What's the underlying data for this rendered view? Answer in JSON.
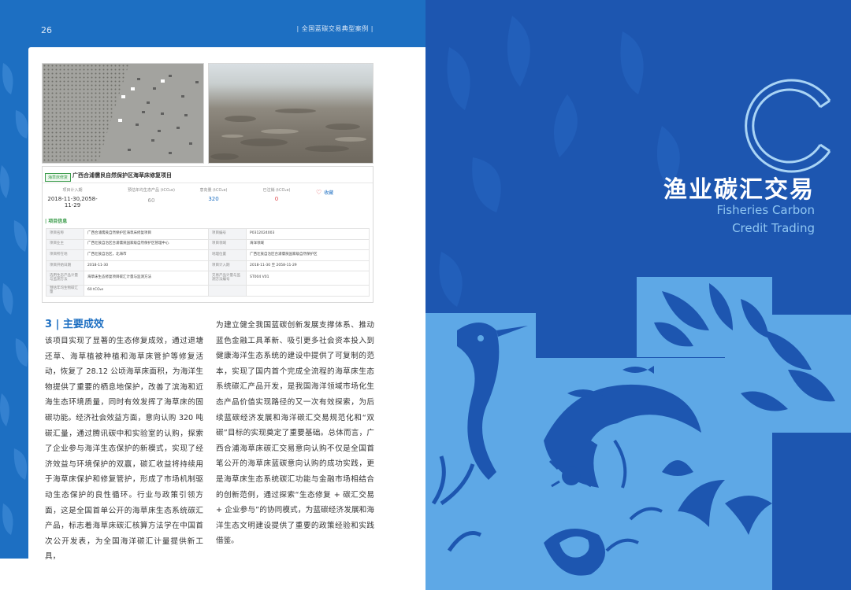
{
  "header": {
    "page_number": "26",
    "running_head": "| 全国蓝碳交易典型案例 |"
  },
  "card": {
    "tag": "海草床修复",
    "title": "广西合浦儒艮自然保护区海草床修复项目",
    "stats": [
      {
        "label": "项目计入期",
        "value": "2018-11-30,2058-11-29",
        "color": "#333333"
      },
      {
        "label": "预估年均生态产品 (tCO₂e)",
        "value": "60",
        "color": "#999999"
      },
      {
        "label": "意向量 (tCO₂e)",
        "value": "320",
        "color": "#1d6fc2"
      },
      {
        "label": "已注销 (tCO₂e)",
        "value": "0",
        "color": "#e0464a"
      }
    ],
    "favorite": "收藏",
    "section_title": "项目信息",
    "rows": [
      [
        "项目名称",
        "广西合浦儒艮自然保护区海草床修复项目",
        "项目编号",
        "P0312024003"
      ],
      [
        "项目业主",
        "广西壮族自治区合浦儒艮国家级自然保护区管理中心",
        "项目领域",
        "海洋领域"
      ],
      [
        "项目所在地",
        "广西壮族自治区，北海市",
        "地理位置",
        "广西壮族自治区合浦儒艮国家级自然保护区"
      ],
      [
        "项目开始日期",
        "2018-11-30",
        "项目计入期",
        "2018-11-30 至 2058-11-29"
      ],
      [
        "选用生态产品计量与监测方法",
        "海草床生态修复项目碳汇计量与监测方法",
        "交易产品计量与监测方法编号",
        "ST004 V01"
      ],
      [
        "预估年均生物碳汇量",
        "60 tCO₂e",
        "",
        ""
      ]
    ]
  },
  "section": {
    "heading": "3 | 主要成效",
    "col1": "该项目实现了显著的生态修复成效，通过退塘还草、海草植被种植和海草床管护等修复活动，恢复了 28.12 公顷海草床面积，为海洋生物提供了重要的栖息地保护，改善了滨海和近海生态环境质量，同时有效发挥了海草床的固碳功能。经济社会效益方面，意向认购 320 吨碳汇量，通过腾讯碳中和实验室的认购，探索了企业参与海洋生态保护的新模式，实现了经济效益与环境保护的双赢，碳汇收益将持续用于海草床保护和修复管护，形成了市场机制驱动生态保护的良性循环。行业与政策引领方面，这是全国首单公开的海草床生态系统碳汇产品，标志着海草床碳汇核算方法学在中国首次公开发表，为全国海洋碳汇计量提供新工具，",
    "col2": "为建立健全我国蓝碳创新发展支撑体系、推动蓝色金融工具革新、吸引更多社会资本投入到健康海洋生态系统的建设中提供了可复制的范本，实现了国内首个完成全流程的海草床生态系统碳汇产品开发，是我国海洋领域市场化生态产品价值实现路径的又一次有效探索，为后续蓝碳经济发展和海洋碳汇交易规范化和“双碳”目标的实现奠定了重要基础。总体而言，广西合浦海草床碳汇交易意向认购不仅是全国首笔公开的海草床蓝碳意向认购的成功实践，更是海草床生态系统碳汇功能与金融市场相结合的创新范例，通过探索“生态修复 + 碳汇交易 + 企业参与”的协同模式，为蓝碳经济发展和海洋生态文明建设提供了重要的政策经验和实践借鉴。"
  },
  "right_page": {
    "title_cn": "渔业碳汇交易",
    "title_en_line1": "Fisheries Carbon",
    "title_en_line2": "Credit Trading",
    "colors": {
      "background": "#1d56b0",
      "art": "#5ea8e6",
      "accent": "#8fc6f2"
    }
  }
}
